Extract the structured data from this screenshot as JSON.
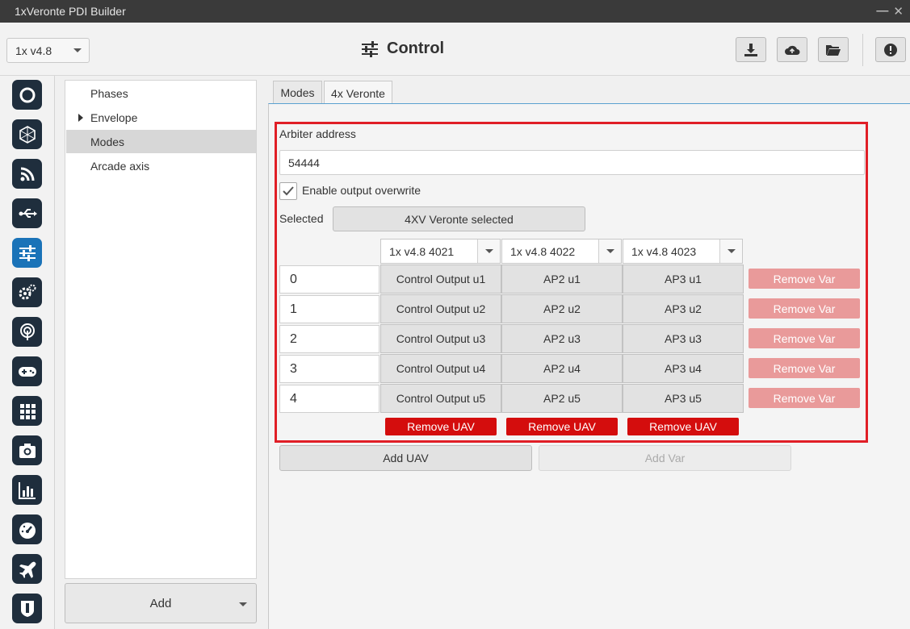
{
  "window": {
    "title": "1xVeronte PDI Builder"
  },
  "header": {
    "version_select": "1x v4.8",
    "page_title": "Control",
    "toolbar_icons": [
      "download-icon",
      "cloud-upload-icon",
      "folder-open-icon",
      "alert-icon"
    ]
  },
  "rail": {
    "icons": [
      "power-icon",
      "airframe-icon",
      "rss-icon",
      "usb-icon",
      "control-sliders-icon",
      "gears-icon",
      "telemetry-icon",
      "gamepad-icon",
      "grid-icon",
      "camera-icon",
      "chart-icon",
      "gauge-icon",
      "airplane-icon",
      "shield-icon"
    ],
    "active": "control-sliders-icon"
  },
  "tree": {
    "items": [
      {
        "label": "Phases",
        "expandable": false,
        "selected": false
      },
      {
        "label": "Envelope",
        "expandable": true,
        "selected": false
      },
      {
        "label": "Modes",
        "expandable": false,
        "selected": true
      },
      {
        "label": "Arcade axis",
        "expandable": false,
        "selected": false
      }
    ],
    "add_label": "Add"
  },
  "tabs": [
    {
      "label": "Modes",
      "active": false
    },
    {
      "label": "4x Veronte",
      "active": true
    }
  ],
  "form": {
    "arbiter_label": "Arbiter address",
    "arbiter_value": "54444",
    "overwrite_label": "Enable output overwrite",
    "overwrite_checked": true,
    "selected_label": "Selected",
    "selected_button": "4XV Veronte selected",
    "uav_columns": [
      "1x v4.8 4021",
      "1x v4.8 4022",
      "1x v4.8 4023"
    ],
    "rows": [
      {
        "index": "0",
        "cells": [
          "Control Output u1",
          "AP2 u1",
          "AP3 u1"
        ]
      },
      {
        "index": "1",
        "cells": [
          "Control Output u2",
          "AP2 u2",
          "AP3 u2"
        ]
      },
      {
        "index": "2",
        "cells": [
          "Control Output u3",
          "AP2 u3",
          "AP3 u3"
        ]
      },
      {
        "index": "3",
        "cells": [
          "Control Output u4",
          "AP2 u4",
          "AP3 u4"
        ]
      },
      {
        "index": "4",
        "cells": [
          "Control Output u5",
          "AP2 u5",
          "AP3 u5"
        ]
      }
    ],
    "remove_var_label": "Remove Var",
    "remove_uav_label": "Remove UAV",
    "add_uav_label": "Add UAV",
    "add_var_label": "Add Var"
  },
  "colors": {
    "highlight_frame": "#e01e26",
    "remove_uav": "#d40d0d",
    "remove_var": "#e99a9a",
    "active_rail": "#1a73b8"
  }
}
